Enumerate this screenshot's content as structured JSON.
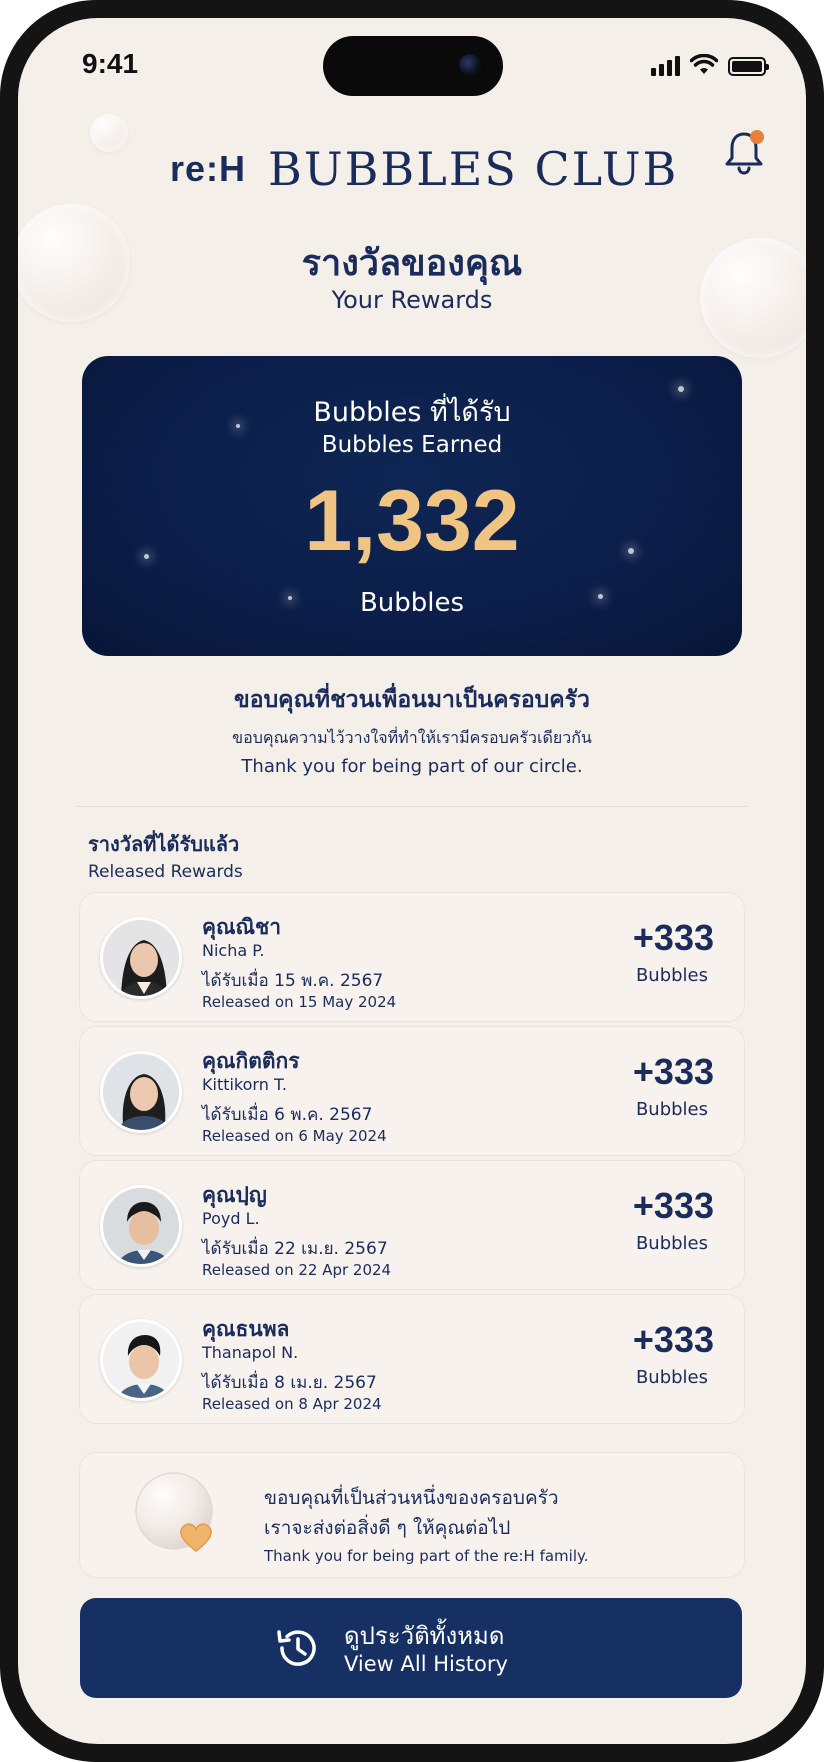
{
  "status_bar": {
    "time": "9:41"
  },
  "header": {
    "brand_logo": "re:H",
    "club_title": "BUBBLES CLUB"
  },
  "page": {
    "title_th": "รางวัลของคุณ",
    "title_en": "Your Rewards"
  },
  "earned_card": {
    "label_th": "Bubbles ที่ได้รับ",
    "label_en": "Bubbles Earned",
    "value": "1,332",
    "unit": "Bubbles"
  },
  "thanks": {
    "line1_th": "ขอบคุณที่ชวนเพื่อนมาเป็นครอบครัว",
    "line2_th": "ขอบคุณความไว้วางใจที่ทำให้เรามีครอบครัวเดียวกัน",
    "line3_en": "Thank you for being part of our circle."
  },
  "released": {
    "title_th": "รางวัลที่ได้รับแล้ว",
    "title_en": "Released Rewards",
    "items": [
      {
        "name_th": "คุณณิชา",
        "name_en": "Nicha P.",
        "date_th": "ได้รับเมื่อ 15 พ.ค. 2567",
        "date_en": "Released on 15 May 2024",
        "points": "+333",
        "unit": "Bubbles"
      },
      {
        "name_th": "คุณกิตติกร",
        "name_en": "Kittikorn T.",
        "date_th": "ได้รับเมื่อ 6 พ.ค. 2567",
        "date_en": "Released on 6 May 2024",
        "points": "+333",
        "unit": "Bubbles"
      },
      {
        "name_th": "คุณปฺญ",
        "name_en": "Poyd L.",
        "date_th": "ได้รับเมื่อ 22 เม.ย. 2567",
        "date_en": "Released on 22 Apr 2024",
        "points": "+333",
        "unit": "Bubbles"
      },
      {
        "name_th": "คุณธนพล",
        "name_en": "Thanapol N.",
        "date_th": "ได้รับเมื่อ 8 เม.ย. 2567",
        "date_en": "Released on 8 Apr 2024",
        "points": "+333",
        "unit": "Bubbles"
      }
    ]
  },
  "footer_note": {
    "line1_th": "ขอบคุณที่เป็นส่วนหนึ่งของครอบครัว",
    "line2_th": "เราจะส่งต่อสิ่งดี ๆ ให้คุณต่อไป",
    "line3_en": "Thank you for being part of the re:H family."
  },
  "history_button": {
    "label_th": "ดูประวัติทั้งหมด",
    "label_en": "View All History"
  },
  "colors": {
    "navy": "#1a2c5b",
    "card_navy": "#0b1d48",
    "gold": "#f0c584",
    "background": "#f5efea",
    "notification_dot": "#e8803a"
  },
  "icons": {
    "bell": "bell-icon",
    "history": "history-clock-icon",
    "heart_bubble": "heart-bubble-icon"
  }
}
